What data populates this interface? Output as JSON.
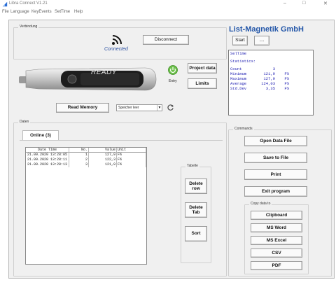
{
  "window": {
    "title": "Libra Connect V1.21",
    "minimize": "–",
    "maximize": "□",
    "close": "✕",
    "app_icon": "blue-triangle-icon"
  },
  "menu": [
    "File",
    "Language",
    "KeyEvents",
    "SetTime",
    "Help"
  ],
  "connection": {
    "group_title": "Verbindung",
    "status": "Connected",
    "status_icon": "wireless-signal-icon",
    "disconnect_label": "Disconnect",
    "device_display": "READY",
    "entry_label": "Entry",
    "entry_icon": "power-icon",
    "project_data_label": "Project data",
    "limits_label": "Limits",
    "read_memory_label": "Read Memory",
    "memory_select_value": "Speicher leer",
    "refresh_icon": "refresh-icon"
  },
  "company": {
    "name": "List-Magnetik GmbH",
    "start_label": "Start",
    "more_label": "....",
    "output_header": "SelTime",
    "output_title": "Statistics:",
    "stats": [
      {
        "key": "Count",
        "value": "3",
        "unit": ""
      },
      {
        "key": "Minimum",
        "value": "121,9",
        "unit": "F%"
      },
      {
        "key": "Maximum",
        "value": "127,9",
        "unit": "F%"
      },
      {
        "key": "Average",
        "value": "124,03",
        "unit": "F%"
      },
      {
        "key": "Std.Dev",
        "value": "3,35",
        "unit": "F%"
      }
    ]
  },
  "data": {
    "group_title": "Daten",
    "tab_label": "Online (3)",
    "columns": [
      "Date Time",
      "No.",
      "Value",
      "Unit"
    ],
    "rows": [
      [
        "21.09.2020 13:28:05",
        "1",
        "127,9",
        "F%"
      ],
      [
        "21.09.2020 13:28:11",
        "2",
        "122,3",
        "F%"
      ],
      [
        "21.09.2020 13:28:13",
        "3",
        "121,9",
        "F%"
      ]
    ],
    "table_group_title": "Tabelle",
    "delete_row_label": "Delete row",
    "delete_tab_label": "Delete Tab",
    "sort_label": "Sort"
  },
  "commands": {
    "group_title": "Commands",
    "open_data_file": "Open Data File",
    "save_to_file": "Save to File",
    "print": "Print",
    "exit_program": "Exit program",
    "copy_group_title": "Copy data to",
    "clipboard": "Clipboard",
    "ms_word": "MS Word",
    "ms_excel": "MS Excel",
    "csv": "CSV",
    "pdf": "PDF"
  },
  "colors": {
    "accent": "#2356a8",
    "output_text": "#1a1ab0",
    "status_text": "#2a4fa0"
  }
}
